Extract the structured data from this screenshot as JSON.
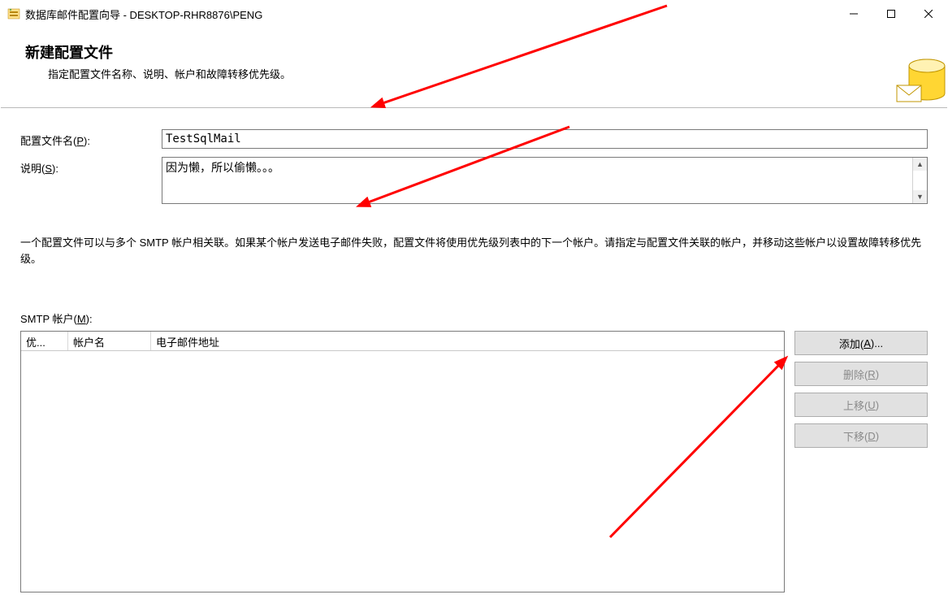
{
  "window": {
    "title": "数据库邮件配置向导 - DESKTOP-RHR8876\\PENG"
  },
  "header": {
    "title": "新建配置文件",
    "subtitle": "指定配置文件名称、说明、帐户和故障转移优先级。"
  },
  "form": {
    "profile_name_label_pre": "配置文件名(",
    "profile_name_label_hot": "P",
    "profile_name_label_post": "):",
    "profile_name_value": "TestSqlMail",
    "desc_label_pre": "说明(",
    "desc_label_hot": "S",
    "desc_label_post": "):",
    "desc_value": "因为懒，所以偷懒。。。"
  },
  "info": "一个配置文件可以与多个 SMTP 帐户相关联。如果某个帐户发送电子邮件失败，配置文件将使用优先级列表中的下一个帐户。请指定与配置文件关联的帐户，并移动这些帐户以设置故障转移优先级。",
  "smtp": {
    "label_pre": "SMTP 帐户(",
    "label_hot": "M",
    "label_post": "):",
    "columns": {
      "priority": "优...",
      "account": "帐户名",
      "email": "电子邮件地址"
    }
  },
  "buttons": {
    "add_pre": "添加(",
    "add_hot": "A",
    "add_post": ")...",
    "remove_pre": "删除(",
    "remove_hot": "R",
    "remove_post": ")",
    "up_pre": "上移(",
    "up_hot": "U",
    "up_post": ")",
    "down_pre": "下移(",
    "down_hot": "D",
    "down_post": ")"
  }
}
